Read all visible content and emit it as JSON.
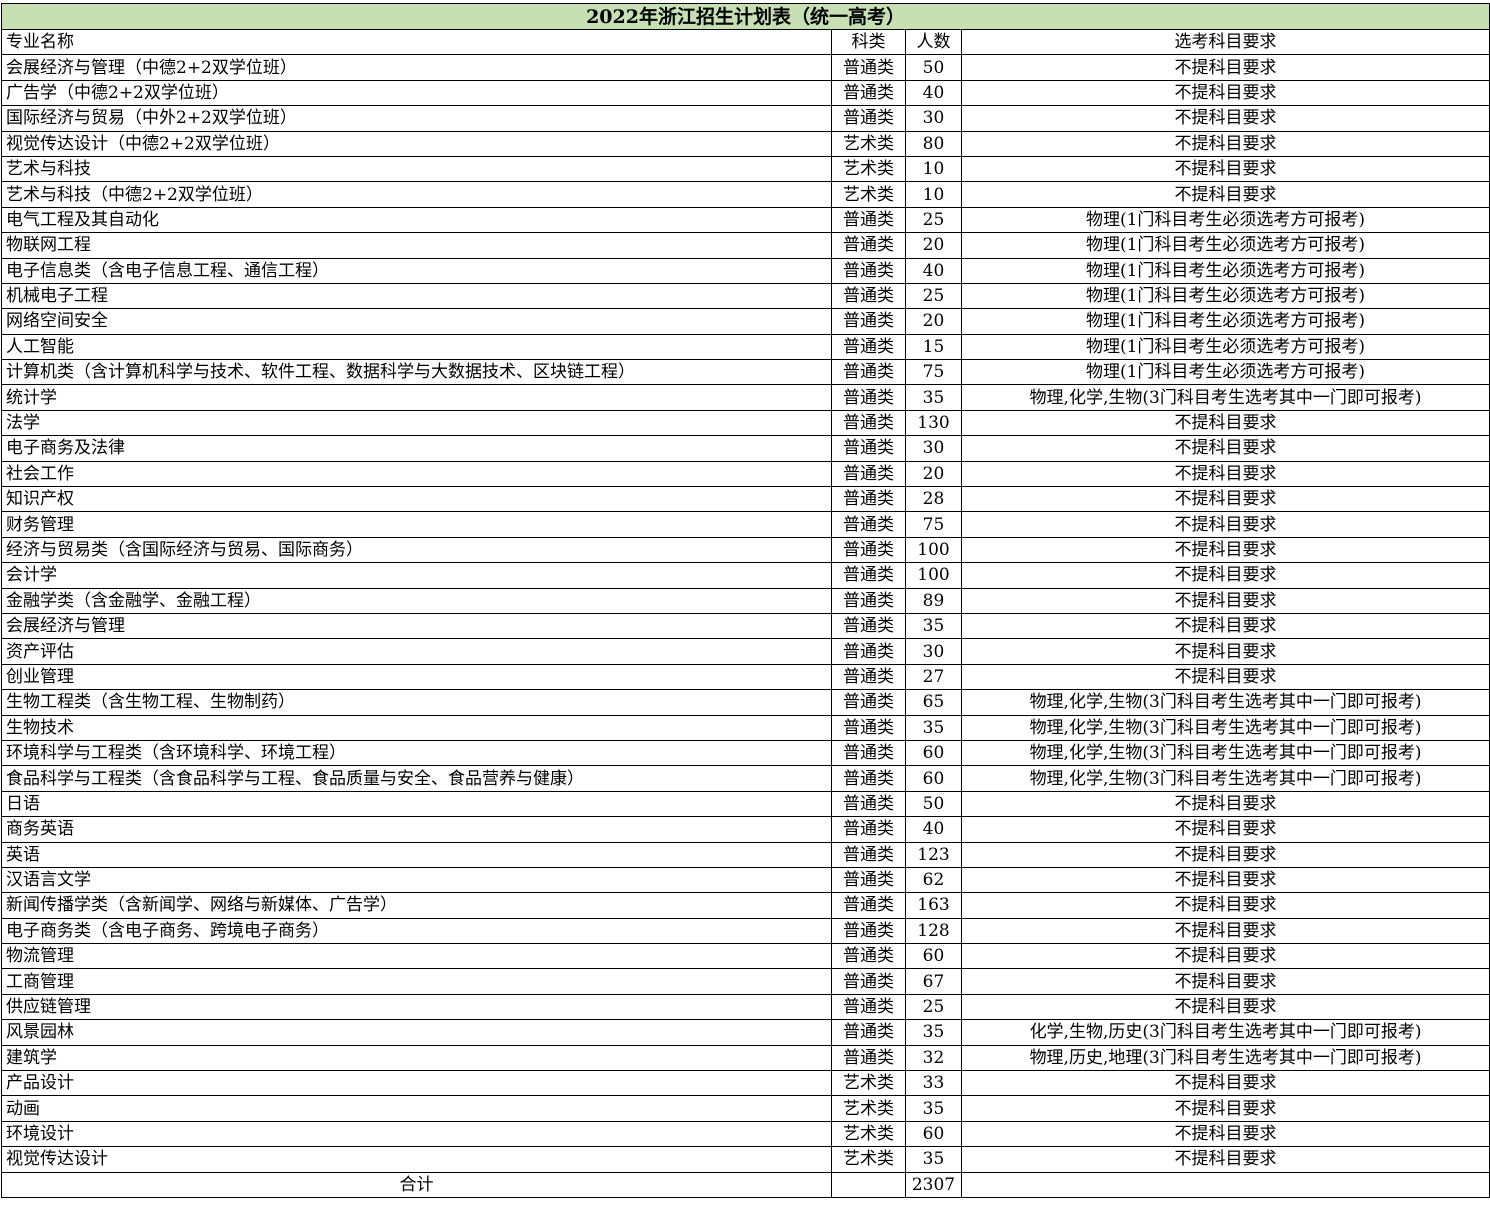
{
  "title": "2022年浙江招生计划表（统一高考）",
  "headers": {
    "name": "专业名称",
    "type": "科类",
    "count": "人数",
    "requirement": "选考科目要求"
  },
  "rows": [
    {
      "name": "会展经济与管理（中德2+2双学位班）",
      "type": "普通类",
      "count": "50",
      "requirement": "不提科目要求"
    },
    {
      "name": "广告学（中德2+2双学位班）",
      "type": "普通类",
      "count": "40",
      "requirement": "不提科目要求"
    },
    {
      "name": "国际经济与贸易（中外2+2双学位班）",
      "type": "普通类",
      "count": "30",
      "requirement": "不提科目要求"
    },
    {
      "name": "视觉传达设计（中德2+2双学位班）",
      "type": "艺术类",
      "count": "80",
      "requirement": "不提科目要求"
    },
    {
      "name": "艺术与科技",
      "type": "艺术类",
      "count": "10",
      "requirement": "不提科目要求"
    },
    {
      "name": "艺术与科技（中德2+2双学位班）",
      "type": "艺术类",
      "count": "10",
      "requirement": "不提科目要求"
    },
    {
      "name": "电气工程及其自动化",
      "type": "普通类",
      "count": "25",
      "requirement": "物理(1门科目考生必须选考方可报考)"
    },
    {
      "name": "物联网工程",
      "type": "普通类",
      "count": "20",
      "requirement": "物理(1门科目考生必须选考方可报考)"
    },
    {
      "name": "电子信息类（含电子信息工程、通信工程）",
      "type": "普通类",
      "count": "40",
      "requirement": "物理(1门科目考生必须选考方可报考)"
    },
    {
      "name": "机械电子工程",
      "type": "普通类",
      "count": "25",
      "requirement": "物理(1门科目考生必须选考方可报考)"
    },
    {
      "name": "网络空间安全",
      "type": "普通类",
      "count": "20",
      "requirement": "物理(1门科目考生必须选考方可报考)"
    },
    {
      "name": "人工智能",
      "type": "普通类",
      "count": "15",
      "requirement": "物理(1门科目考生必须选考方可报考)"
    },
    {
      "name": "计算机类（含计算机科学与技术、软件工程、数据科学与大数据技术、区块链工程）",
      "type": "普通类",
      "count": "75",
      "requirement": "物理(1门科目考生必须选考方可报考)"
    },
    {
      "name": "统计学",
      "type": "普通类",
      "count": "35",
      "requirement": "物理,化学,生物(3门科目考生选考其中一门即可报考)"
    },
    {
      "name": "法学",
      "type": "普通类",
      "count": "130",
      "requirement": "不提科目要求"
    },
    {
      "name": "电子商务及法律",
      "type": "普通类",
      "count": "30",
      "requirement": "不提科目要求"
    },
    {
      "name": "社会工作",
      "type": "普通类",
      "count": "20",
      "requirement": "不提科目要求"
    },
    {
      "name": "知识产权",
      "type": "普通类",
      "count": "28",
      "requirement": "不提科目要求"
    },
    {
      "name": "财务管理",
      "type": "普通类",
      "count": "75",
      "requirement": "不提科目要求"
    },
    {
      "name": "经济与贸易类（含国际经济与贸易、国际商务）",
      "type": "普通类",
      "count": "100",
      "requirement": "不提科目要求"
    },
    {
      "name": "会计学",
      "type": "普通类",
      "count": "100",
      "requirement": "不提科目要求"
    },
    {
      "name": "金融学类（含金融学、金融工程）",
      "type": "普通类",
      "count": "89",
      "requirement": "不提科目要求"
    },
    {
      "name": "会展经济与管理",
      "type": "普通类",
      "count": "35",
      "requirement": "不提科目要求"
    },
    {
      "name": "资产评估",
      "type": "普通类",
      "count": "30",
      "requirement": "不提科目要求"
    },
    {
      "name": "创业管理",
      "type": "普通类",
      "count": "27",
      "requirement": "不提科目要求"
    },
    {
      "name": "生物工程类（含生物工程、生物制药）",
      "type": "普通类",
      "count": "65",
      "requirement": "物理,化学,生物(3门科目考生选考其中一门即可报考)"
    },
    {
      "name": "生物技术",
      "type": "普通类",
      "count": "35",
      "requirement": "物理,化学,生物(3门科目考生选考其中一门即可报考)"
    },
    {
      "name": "环境科学与工程类（含环境科学、环境工程）",
      "type": "普通类",
      "count": "60",
      "requirement": "物理,化学,生物(3门科目考生选考其中一门即可报考)"
    },
    {
      "name": "食品科学与工程类（含食品科学与工程、食品质量与安全、食品营养与健康）",
      "type": "普通类",
      "count": "60",
      "requirement": "物理,化学,生物(3门科目考生选考其中一门即可报考)"
    },
    {
      "name": "日语",
      "type": "普通类",
      "count": "50",
      "requirement": "不提科目要求"
    },
    {
      "name": "商务英语",
      "type": "普通类",
      "count": "40",
      "requirement": "不提科目要求"
    },
    {
      "name": "英语",
      "type": "普通类",
      "count": "123",
      "requirement": "不提科目要求"
    },
    {
      "name": "汉语言文学",
      "type": "普通类",
      "count": "62",
      "requirement": "不提科目要求"
    },
    {
      "name": "新闻传播学类（含新闻学、网络与新媒体、广告学）",
      "type": "普通类",
      "count": "163",
      "requirement": "不提科目要求"
    },
    {
      "name": "电子商务类（含电子商务、跨境电子商务）",
      "type": "普通类",
      "count": "128",
      "requirement": "不提科目要求"
    },
    {
      "name": "物流管理",
      "type": "普通类",
      "count": "60",
      "requirement": "不提科目要求"
    },
    {
      "name": "工商管理",
      "type": "普通类",
      "count": "67",
      "requirement": "不提科目要求"
    },
    {
      "name": "供应链管理",
      "type": "普通类",
      "count": "25",
      "requirement": "不提科目要求"
    },
    {
      "name": "风景园林",
      "type": "普通类",
      "count": "35",
      "requirement": "化学,生物,历史(3门科目考生选考其中一门即可报考)"
    },
    {
      "name": "建筑学",
      "type": "普通类",
      "count": "32",
      "requirement": "物理,历史,地理(3门科目考生选考其中一门即可报考)"
    },
    {
      "name": "产品设计",
      "type": "艺术类",
      "count": "33",
      "requirement": "不提科目要求"
    },
    {
      "name": "动画",
      "type": "艺术类",
      "count": "35",
      "requirement": "不提科目要求"
    },
    {
      "name": "环境设计",
      "type": "艺术类",
      "count": "60",
      "requirement": "不提科目要求"
    },
    {
      "name": "视觉传达设计",
      "type": "艺术类",
      "count": "35",
      "requirement": "不提科目要求"
    }
  ],
  "total": {
    "label": "合计",
    "count": "2307"
  },
  "colors": {
    "title_background": "#c6e0b4"
  }
}
